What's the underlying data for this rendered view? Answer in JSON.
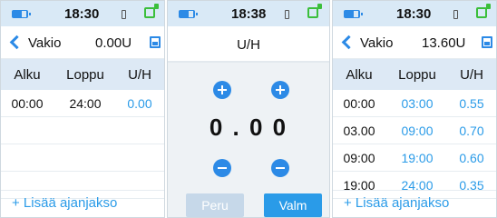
{
  "colors": {
    "accent": "#2c8ae6",
    "value_blue": "#2a9be8",
    "status_bg": "#d9e9f6",
    "table_header_bg": "#dde9f5"
  },
  "left_panel": {
    "status": {
      "time": "18:30"
    },
    "header": {
      "title": "Vakio",
      "value": "0.00U"
    },
    "columns": [
      "Alku",
      "Loppu",
      "U/H"
    ],
    "rows": [
      {
        "start": "00:00",
        "end": "24:00",
        "rate": "0.00"
      }
    ],
    "add_label": "+ Lisää ajanjakso"
  },
  "middle_panel": {
    "status": {
      "time": "18:38"
    },
    "title": "U/H",
    "value": "0 . 0 0",
    "cancel_label": "Peru",
    "confirm_label": "Valm"
  },
  "right_panel": {
    "status": {
      "time": "18:30"
    },
    "header": {
      "title": "Vakio",
      "value": "13.60U"
    },
    "columns": [
      "Alku",
      "Loppu",
      "U/H"
    ],
    "rows": [
      {
        "start": "00:00",
        "end": "03:00",
        "rate": "0.55"
      },
      {
        "start": "03.00",
        "end": "09:00",
        "rate": "0.70"
      },
      {
        "start": "09:00",
        "end": "19:00",
        "rate": "0.60"
      },
      {
        "start": "19:00",
        "end": "24:00",
        "rate": "0.35"
      }
    ],
    "add_label": "+ Lisää ajanjakso"
  }
}
